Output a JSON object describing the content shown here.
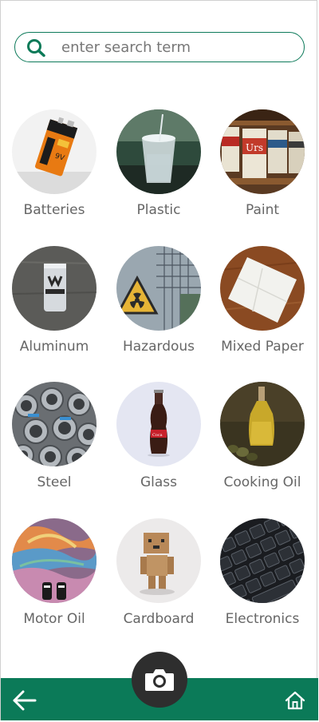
{
  "search": {
    "placeholder": "enter search term"
  },
  "categories": [
    {
      "label": "Batteries",
      "icon": "battery-photo"
    },
    {
      "label": "Plastic",
      "icon": "plastic-cup-photo"
    },
    {
      "label": "Paint",
      "icon": "paint-cans-photo"
    },
    {
      "label": "Aluminum",
      "icon": "aluminum-can-photo"
    },
    {
      "label": "Hazardous",
      "icon": "radiation-sign-photo"
    },
    {
      "label": "Mixed Paper",
      "icon": "folded-paper-photo"
    },
    {
      "label": "Steel",
      "icon": "steel-pipes-photo"
    },
    {
      "label": "Glass",
      "icon": "glass-bottle-photo"
    },
    {
      "label": "Cooking Oil",
      "icon": "oil-bottle-photo"
    },
    {
      "label": "Motor Oil",
      "icon": "oil-slick-photo"
    },
    {
      "label": "Cardboard",
      "icon": "cardboard-robot-photo"
    },
    {
      "label": "Electronics",
      "icon": "keyboard-photo"
    }
  ],
  "colors": {
    "brand_green": "#0b7a58",
    "camera_button": "#2e2e2e",
    "label_text": "#666666"
  },
  "nav": {
    "back_icon": "arrow-left-icon",
    "home_icon": "home-icon",
    "camera_icon": "camera-icon"
  }
}
